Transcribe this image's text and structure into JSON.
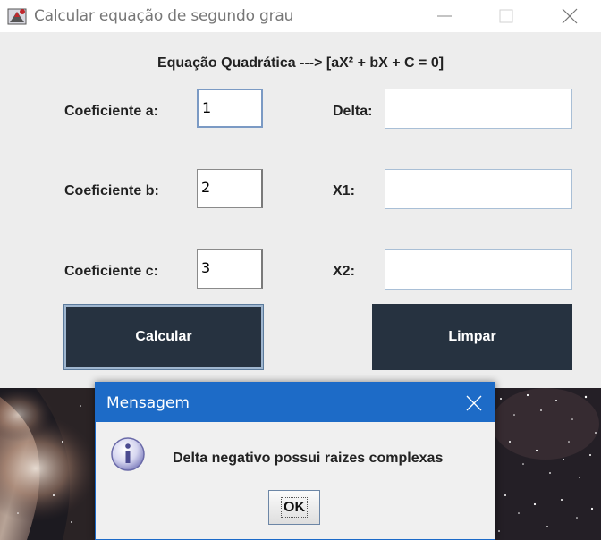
{
  "window": {
    "title": "Calcular equação de segundo grau",
    "controls": [
      "minimize-icon",
      "maximize-icon",
      "close-icon"
    ]
  },
  "form": {
    "heading": "Equação Quadrática ---> [aX² + bX + C = 0]",
    "coef_a_label": "Coeficiente a:",
    "coef_a_value": "1",
    "coef_b_label": "Coeficiente b:",
    "coef_b_value": "2",
    "coef_c_label": "Coeficiente c:",
    "coef_c_value": "3",
    "delta_label": "Delta:",
    "delta_value": "",
    "x1_label": "X1:",
    "x1_value": "",
    "x2_label": "X2:",
    "x2_value": "",
    "calc_button": "Calcular",
    "clear_button": "Limpar"
  },
  "dialog": {
    "title": "Mensagem",
    "message": "Delta negativo possui raizes complexas",
    "ok_button": "OK",
    "icon": "info-icon"
  },
  "colors": {
    "button_bg": "#263240",
    "dialog_title_bg": "#1d6bc7",
    "window_bg": "#ededed"
  }
}
